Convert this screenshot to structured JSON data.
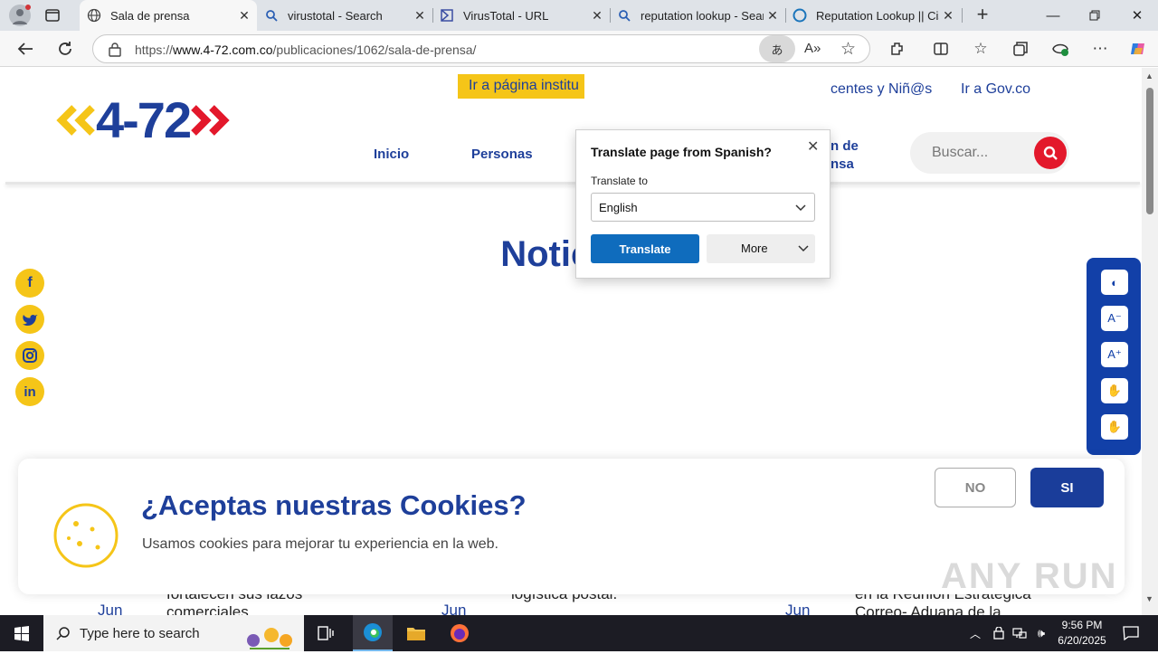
{
  "browser": {
    "tabs": [
      {
        "label": "Sala de prensa",
        "icon": "globe-icon",
        "active": true
      },
      {
        "label": "virustotal - Search",
        "icon": "search-icon",
        "active": false
      },
      {
        "label": "VirusTotal - URL",
        "icon": "virustotal-icon",
        "active": false
      },
      {
        "label": "reputation lookup - Search",
        "icon": "search-icon",
        "active": false
      },
      {
        "label": "Reputation Lookup || Cisco",
        "icon": "cisco-icon",
        "active": false
      }
    ],
    "url_prefix": "https://",
    "url_host": "www.4-72.com.co",
    "url_path": "/publicaciones/1062/sala-de-prensa/"
  },
  "translate_popup": {
    "title": "Translate page from Spanish?",
    "label": "Translate to",
    "selected_language": "English",
    "translate_button": "Translate",
    "more_button": "More"
  },
  "site": {
    "logo_text": "4-72",
    "top_links": {
      "institutional": "Ir a página institu",
      "children": "centes y Niñ@s",
      "gov": "Ir a Gov.co"
    },
    "nav": {
      "inicio": "Inicio",
      "personas": "Personas",
      "sala_line1": "n de",
      "sala_line2": "nsa"
    },
    "search_placeholder": "Buscar...",
    "heading": "Noticias",
    "accessibility": {
      "contrast": "◐",
      "font_minus": "A⁻",
      "font_plus": "A⁺"
    },
    "news_peek": [
      {
        "month": "Jun",
        "text_line1": "fortalecen sus lazos",
        "text_line2": "comerciales"
      },
      {
        "month": "Jun",
        "text_line1": "logística postal.",
        "text_line2": ""
      },
      {
        "month": "Jun",
        "text_line1": "en la Reunión Estratégica",
        "text_line2": "Correo- Aduana de la"
      }
    ]
  },
  "cookies": {
    "title": "¿Aceptas nuestras Cookies?",
    "text": "Usamos cookies para mejorar tu experiencia en la web.",
    "no_button": "NO",
    "yes_button": "SI"
  },
  "watermark": "ANY RUN",
  "taskbar": {
    "search_placeholder": "Type here to search",
    "time": "9:56 PM",
    "date": "6/20/2025"
  },
  "colors": {
    "brand_blue": "#1e3f9a",
    "brand_red": "#e3182b",
    "brand_yellow": "#f5c518",
    "edge_blue": "#0f6cbd"
  }
}
